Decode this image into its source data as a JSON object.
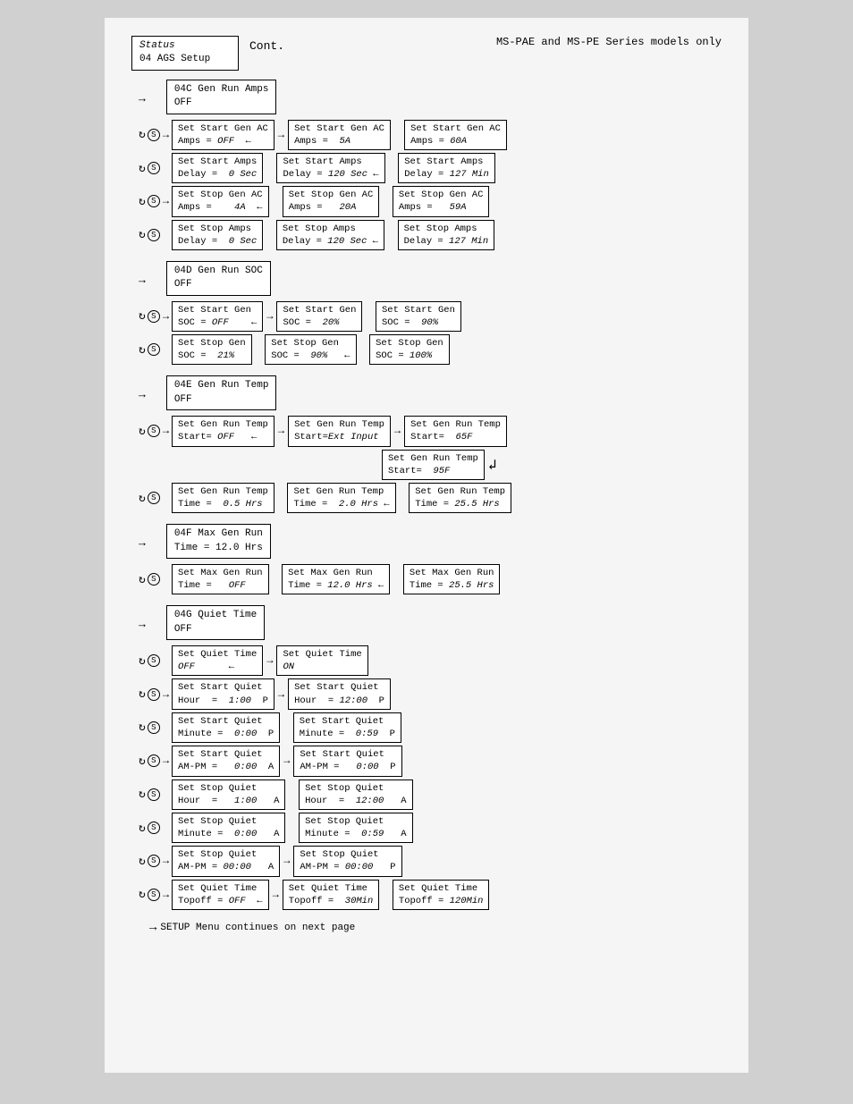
{
  "header": {
    "status_label": "Status",
    "status_sub": "04 AGS Setup",
    "cont": "Cont.",
    "ms_label": "MS-PAE and MS-PE Series models only"
  },
  "sections": {
    "sec_04c": {
      "title": "04C Gen Run Amps",
      "subtitle": "OFF"
    },
    "sec_04d": {
      "title": "04D Gen Run SOC",
      "subtitle": "OFF"
    },
    "sec_04e": {
      "title": "04E Gen Run Temp",
      "subtitle": "OFF"
    },
    "sec_04f": {
      "title": "04F Max Gen Run",
      "subtitle": "Time = 12.0 Hrs"
    },
    "sec_04g": {
      "title": "04G Quiet Time",
      "subtitle": "OFF"
    }
  },
  "setup_continues": "SETUP Menu continues on next page"
}
